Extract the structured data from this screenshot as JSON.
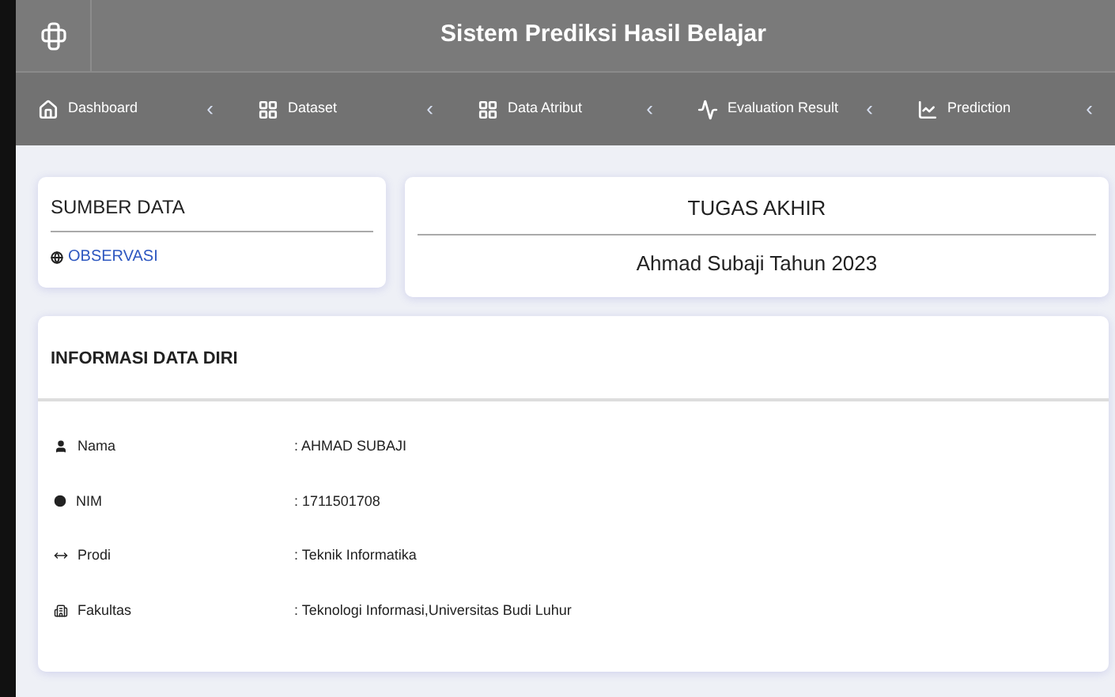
{
  "header": {
    "title": "Sistem Prediksi Hasil Belajar"
  },
  "nav": [
    {
      "label": "Dashboard",
      "kind": "home",
      "chevron": "‹"
    },
    {
      "label": "Dataset",
      "kind": "grid",
      "chevron": "‹"
    },
    {
      "label": "Data Atribut",
      "kind": "grid",
      "chevron": "‹"
    },
    {
      "label": "Evaluation Result",
      "kind": "wave",
      "chevron": "‹"
    },
    {
      "label": "Prediction",
      "kind": "chart",
      "chevron": "‹"
    }
  ],
  "source_card": {
    "title": "SUMBER DATA",
    "link": "OBSERVASI"
  },
  "project_card": {
    "title": "TUGAS AKHIR",
    "subtitle": "Ahmad Subaji Tahun 2023"
  },
  "info_card": {
    "title": "INFORMASI DATA DIRI",
    "rows": [
      {
        "label": "Nama",
        "kind": "user",
        "value": ": AHMAD SUBAJI"
      },
      {
        "label": "NIM",
        "kind": "dot",
        "value": ": 1711501708"
      },
      {
        "label": "Prodi",
        "kind": "arrows",
        "value": ": Teknik Informatika"
      },
      {
        "label": "Fakultas",
        "kind": "building",
        "value": ": Teknologi Informasi,Universitas Budi Luhur"
      }
    ]
  }
}
